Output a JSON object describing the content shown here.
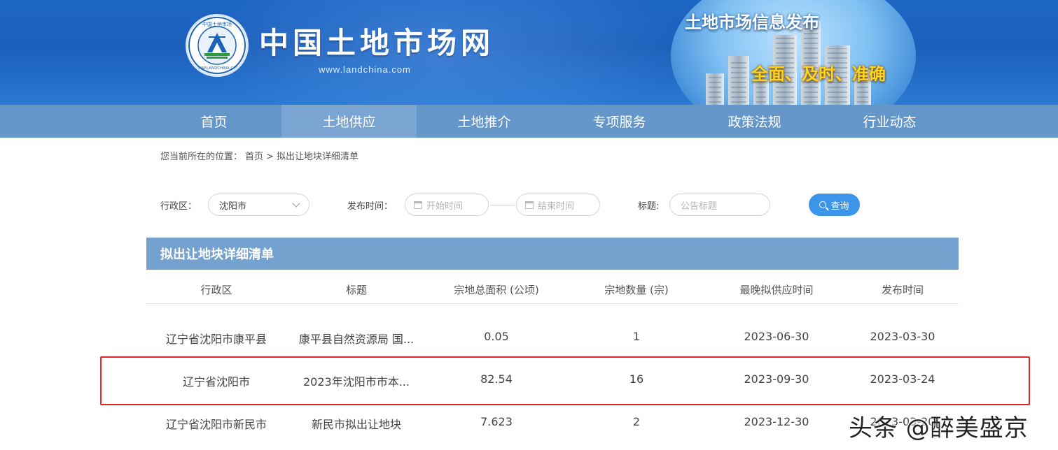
{
  "site": {
    "title": "中国土地市场网",
    "url": "www.landchina.com",
    "slogan_main": "土地市场信息发布",
    "slogan_sub": "全面、及时、准确"
  },
  "nav": {
    "items": [
      {
        "label": "首页"
      },
      {
        "label": "土地供应"
      },
      {
        "label": "土地推介"
      },
      {
        "label": "专项服务"
      },
      {
        "label": "政策法规"
      },
      {
        "label": "行业动态"
      }
    ],
    "active": "土地供应"
  },
  "breadcrumb": {
    "prefix": "您当前所在的位置：",
    "home": "首页",
    "separator": ">",
    "current": "拟出让地块详细清单"
  },
  "filters": {
    "region_label": "行政区：",
    "region_value": "沈阳市",
    "publish_time_label": "发布时间：",
    "start_placeholder": "开始时间",
    "end_placeholder": "结束时间",
    "title_label": "标题:",
    "title_placeholder": "公告标题",
    "query_label": "查询"
  },
  "table": {
    "title": "拟出让地块详细清单",
    "columns": [
      "行政区",
      "标题",
      "宗地总面积 (公顷)",
      "宗地数量 (宗)",
      "最晚拟供应时间",
      "发布时间"
    ],
    "rows": [
      [
        "辽宁省沈阳市康平县",
        "康平县自然资源局 国...",
        "0.05",
        "1",
        "2023-06-30",
        "2023-03-30"
      ],
      [
        "辽宁省沈阳市",
        "2023年沈阳市市本...",
        "82.54",
        "16",
        "2023-09-30",
        "2023-03-24"
      ],
      [
        "辽宁省沈阳市新民市",
        "新民市拟出让地块",
        "7.623",
        "2",
        "2023-12-30",
        "2023-03-20"
      ]
    ]
  },
  "watermark": "头条 @醉美盛京",
  "colors": {
    "banner": "#1e66c4",
    "nav": "#6596c9",
    "nav_active": "#7aa4d1",
    "table_title_bar": "#74a1cd",
    "query_button": "#3d95ea",
    "highlight_border": "#e2252b"
  }
}
